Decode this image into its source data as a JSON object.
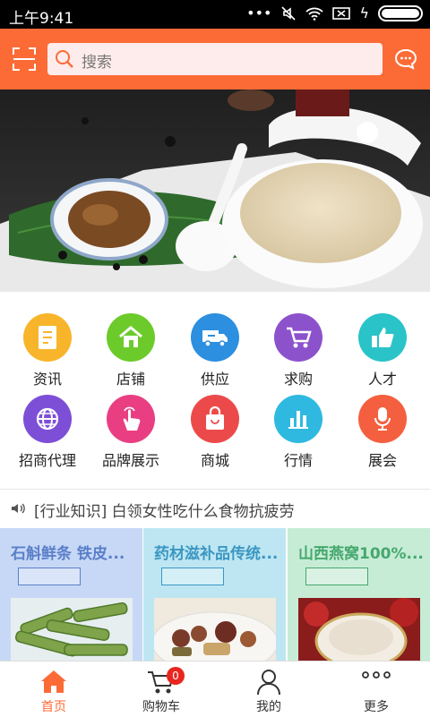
{
  "status_bar": {
    "time": "上午9:41"
  },
  "header": {
    "search_placeholder": "搜索"
  },
  "categories": [
    {
      "label": "资讯",
      "icon": "news-icon",
      "color": "#f8b52b"
    },
    {
      "label": "店铺",
      "icon": "shop-icon",
      "color": "#6ccb2b"
    },
    {
      "label": "供应",
      "icon": "truck-icon",
      "color": "#2c8fe0"
    },
    {
      "label": "求购",
      "icon": "cart-icon",
      "color": "#8c52cc"
    },
    {
      "label": "人才",
      "icon": "thumbs-up-icon",
      "color": "#29c3c8"
    },
    {
      "label": "招商代理",
      "icon": "globe-icon",
      "color": "#7d4fd6"
    },
    {
      "label": "品牌展示",
      "icon": "tap-icon",
      "color": "#e93f82"
    },
    {
      "label": "商城",
      "icon": "bag-icon",
      "color": "#ec4a4a"
    },
    {
      "label": "行情",
      "icon": "bar-chart-icon",
      "color": "#2fb9e0"
    },
    {
      "label": "展会",
      "icon": "mic-icon",
      "color": "#f45f3f"
    }
  ],
  "news": {
    "text": "[行业知识] 白领女性吃什么食物抗疲劳"
  },
  "cards": [
    {
      "title": "石斛鲜条 铁皮...",
      "bg": "#c7d8f7",
      "color": "#5a7fc8"
    },
    {
      "title": "药材滋补品传统...",
      "bg": "#bde6f2",
      "color": "#3b97c2"
    },
    {
      "title": "山西燕窝100%...",
      "bg": "#c7ecd6",
      "color": "#45a86e"
    }
  ],
  "tabbar": {
    "home": "首页",
    "cart": "购物车",
    "cart_count": "0",
    "mine": "我的",
    "more": "更多"
  },
  "accent": "#fc6b36"
}
